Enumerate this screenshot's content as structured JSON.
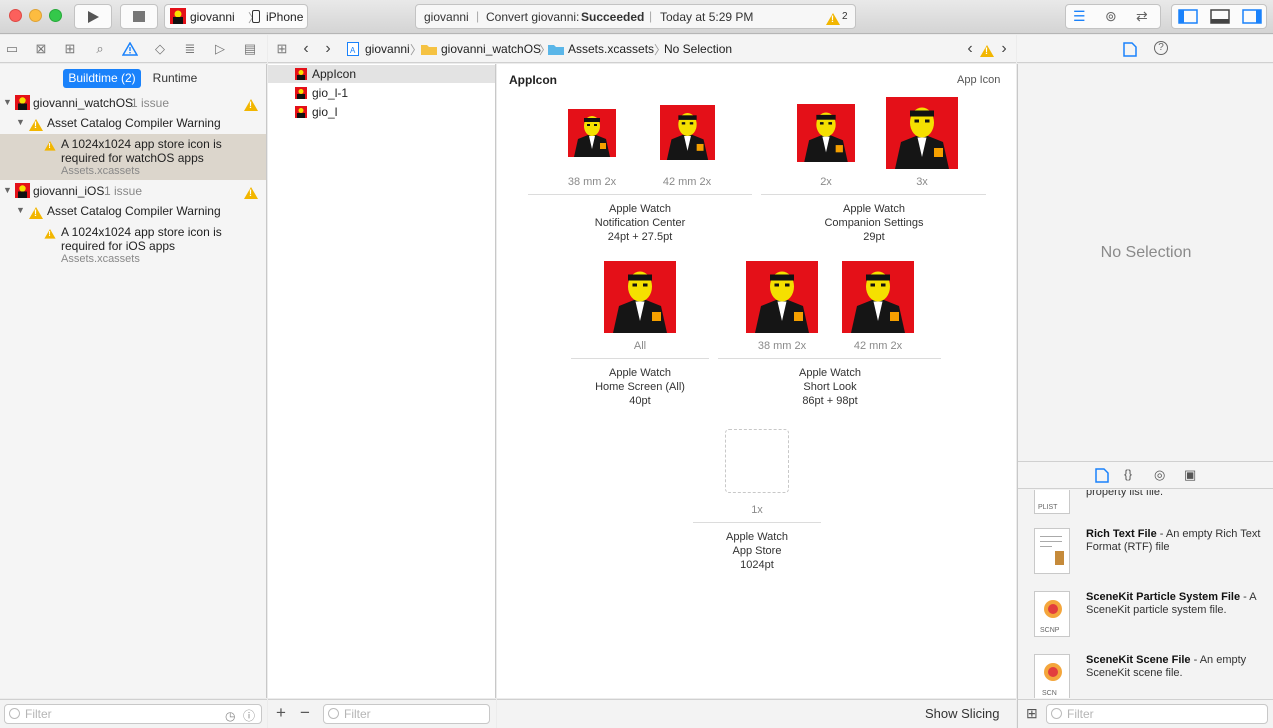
{
  "toolbar": {
    "scheme_project": "giovanni",
    "scheme_device": "iPhone",
    "activity_project": "giovanni",
    "activity_action": "Convert giovanni:",
    "activity_status": "Succeeded",
    "activity_time": "Today at 5:29 PM",
    "warning_count": "2"
  },
  "issue_navigator": {
    "tabs": [
      {
        "label": "Buildtime (2)",
        "selected": true
      },
      {
        "label": "Runtime",
        "selected": false
      }
    ],
    "groups": [
      {
        "target": "giovanni_watchOS",
        "count": "1 issue",
        "category": "Asset Catalog Compiler Warning",
        "message": "A 1024x1024 app store icon is required for watchOS apps",
        "file": "Assets.xcassets"
      },
      {
        "target": "giovanni_iOS",
        "count": "1 issue",
        "category": "Asset Catalog Compiler Warning",
        "message": "A 1024x1024 app store icon is required for iOS apps",
        "file": "Assets.xcassets"
      }
    ],
    "filter_placeholder": "Filter"
  },
  "jump_bar": {
    "crumbs": [
      "giovanni",
      "giovanni_watchOS",
      "Assets.xcassets",
      "No Selection"
    ]
  },
  "asset_list": {
    "items": [
      "AppIcon",
      "gio_l-1",
      "gio_l"
    ],
    "filter_placeholder": "Filter"
  },
  "editor": {
    "title": "AppIcon",
    "type_label": "App Icon",
    "groups": [
      {
        "slots": [
          "38 mm 2x",
          "42 mm 2x"
        ],
        "line1": "Apple Watch",
        "line2": "Notification Center",
        "line3": "24pt + 27.5pt"
      },
      {
        "slots": [
          "2x",
          "3x"
        ],
        "line1": "Apple Watch",
        "line2": "Companion Settings",
        "line3": "29pt"
      },
      {
        "slots": [
          "All"
        ],
        "line1": "Apple Watch",
        "line2": "Home Screen (All)",
        "line3": "40pt"
      },
      {
        "slots": [
          "38 mm 2x",
          "42 mm 2x"
        ],
        "line1": "Apple Watch",
        "line2": "Short Look",
        "line3": "86pt + 98pt"
      },
      {
        "slots": [
          "1x"
        ],
        "line1": "Apple Watch",
        "line2": "App Store",
        "line3": "1024pt"
      }
    ],
    "show_slicing": "Show Slicing"
  },
  "inspector": {
    "empty_label": "No Selection"
  },
  "library": {
    "partial_text": "property list file.",
    "partial_badge": "PLIST",
    "items": [
      {
        "name": "Rich Text File",
        "desc": " - An empty Rich Text Format (RTF) file",
        "badge": ""
      },
      {
        "name": "SceneKit Particle System File",
        "desc": " - A SceneKit particle system file.",
        "badge": "SCNP"
      },
      {
        "name": "SceneKit Scene File",
        "desc": " - An empty SceneKit scene file.",
        "badge": "SCN"
      }
    ],
    "filter_placeholder": "Filter"
  },
  "colors": {
    "accent": "#1a82fb",
    "warning": "#f2b600",
    "icon_red": "#e41018"
  }
}
